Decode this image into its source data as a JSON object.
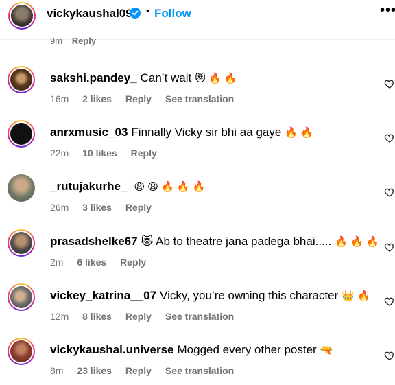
{
  "header": {
    "username": "vickykaushal09",
    "separator": "•",
    "follow_label": "Follow",
    "more_label": "•••",
    "accent_color": "#0095f6"
  },
  "previous_comment": {
    "time": "9m",
    "reply": "Reply"
  },
  "comments": [
    {
      "username": "sakshi.pandey_",
      "text": "Can’t wait",
      "emoji": "😻 🔥 🔥",
      "time": "16m",
      "likes": "2 likes",
      "reply": "Reply",
      "translation": "See translation"
    },
    {
      "username": "anrxmusic_03",
      "text": "Finnally Vicky sir bhi aa gaye",
      "emoji": "🔥 🔥",
      "time": "22m",
      "likes": "10 likes",
      "reply": "Reply",
      "translation": ""
    },
    {
      "username": "_rutujakurhe_",
      "text": "",
      "emoji": "😩 😩 🔥 🔥 🔥",
      "time": "26m",
      "likes": "3 likes",
      "reply": "Reply",
      "translation": ""
    },
    {
      "username": "prasadshelke67",
      "text": "😻 Ab to theatre jana padega bhai.....",
      "emoji": "🔥 🔥 🔥",
      "time": "2m",
      "likes": "6 likes",
      "reply": "Reply",
      "translation": ""
    },
    {
      "username": "vickey_katrina__07",
      "text": "Vicky, you’re owning this character",
      "emoji": "👑 🔥",
      "time": "12m",
      "likes": "8 likes",
      "reply": "Reply",
      "translation": "See translation"
    },
    {
      "username": "vickykaushal.universe",
      "text": "Mogged every other poster",
      "emoji": "🔫",
      "time": "8m",
      "likes": "23 likes",
      "reply": "Reply",
      "translation": "See translation"
    }
  ]
}
